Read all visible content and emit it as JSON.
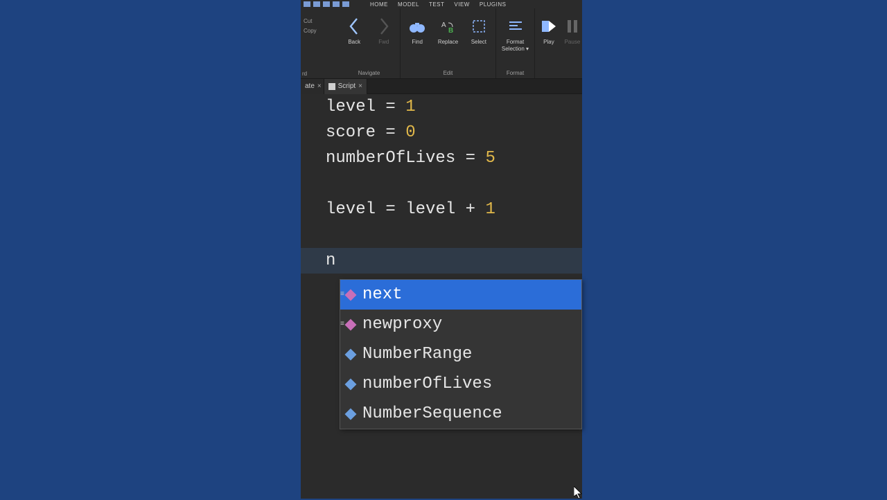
{
  "menu": {
    "items": [
      "HOME",
      "MODEL",
      "TEST",
      "VIEW",
      "PLUGINS"
    ]
  },
  "clipboard": {
    "cut": "Cut",
    "copy": "Copy"
  },
  "ribbon": {
    "groups": [
      {
        "label": "Navigate",
        "buttons": [
          {
            "label": "Back",
            "icon": "chevron-left",
            "enabled": true
          },
          {
            "label": "Fwd",
            "icon": "chevron-right",
            "enabled": false
          }
        ]
      },
      {
        "label": "Edit",
        "buttons": [
          {
            "label": "Find",
            "icon": "binoculars",
            "enabled": true
          },
          {
            "label": "Replace",
            "icon": "replace",
            "enabled": true
          },
          {
            "label": "Select",
            "icon": "select",
            "enabled": true
          }
        ]
      },
      {
        "label": "Format",
        "buttons": [
          {
            "label": "Format Selection",
            "icon": "format",
            "enabled": true
          }
        ]
      },
      {
        "label": "",
        "buttons": [
          {
            "label": "Play",
            "icon": "play",
            "enabled": true
          },
          {
            "label": "Pause",
            "icon": "pause",
            "enabled": false
          }
        ]
      }
    ]
  },
  "partial_left_label": "rd",
  "tabs": {
    "items": [
      {
        "label": "ate",
        "active": false,
        "partial": true
      },
      {
        "label": "Script",
        "active": true,
        "partial": false
      }
    ]
  },
  "code": {
    "lines": [
      {
        "tokens": [
          {
            "t": "id",
            "v": "level"
          },
          {
            "t": "op",
            "v": " = "
          },
          {
            "t": "num",
            "v": "1"
          }
        ]
      },
      {
        "tokens": [
          {
            "t": "id",
            "v": "score"
          },
          {
            "t": "op",
            "v": " = "
          },
          {
            "t": "num",
            "v": "0"
          }
        ]
      },
      {
        "tokens": [
          {
            "t": "id",
            "v": "numberOfLives"
          },
          {
            "t": "op",
            "v": " = "
          },
          {
            "t": "num",
            "v": "5"
          }
        ]
      },
      {
        "tokens": []
      },
      {
        "tokens": [
          {
            "t": "id",
            "v": "level"
          },
          {
            "t": "op",
            "v": " = "
          },
          {
            "t": "id",
            "v": "level"
          },
          {
            "t": "op",
            "v": " + "
          },
          {
            "t": "num",
            "v": "1"
          }
        ]
      },
      {
        "tokens": []
      },
      {
        "tokens": [
          {
            "t": "id",
            "v": "n"
          }
        ],
        "current": true
      }
    ]
  },
  "autocomplete": {
    "items": [
      {
        "label": "next",
        "kind": "func",
        "selected": true
      },
      {
        "label": "newproxy",
        "kind": "func",
        "selected": false
      },
      {
        "label": "NumberRange",
        "kind": "var",
        "selected": false
      },
      {
        "label": "numberOfLives",
        "kind": "var",
        "selected": false
      },
      {
        "label": "NumberSequence",
        "kind": "var",
        "selected": false
      }
    ]
  }
}
